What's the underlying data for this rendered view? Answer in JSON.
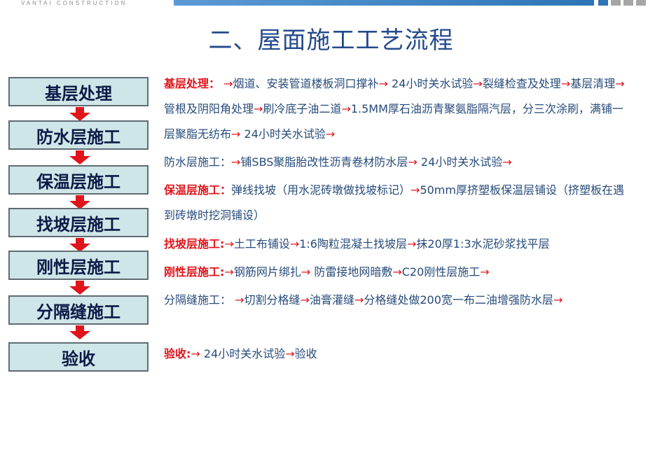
{
  "header": {
    "brand": "VANTAI CONSTRUCTION",
    "title": "二、屋面施工工艺流程"
  },
  "steps": [
    "基层处理",
    "防水层施工",
    "保温层施工",
    "找坡层施工",
    "刚性层施工",
    "分隔缝施工",
    "验收"
  ],
  "arrow_symbol": "→",
  "descriptions": {
    "jiceng": {
      "label": "基层处理：",
      "parts": [
        "烟道、安装管道楼板洞口撑补",
        " 24小时关水试验",
        "裂缝检查及处理",
        "基层清理",
        "管根及阴阳角处理",
        "刷冷底子油二道",
        "1.5MM厚石油沥青聚氨脂隔汽层，分三次涂刷，满铺一层聚脂无纺布",
        " 24小时关水试验"
      ]
    },
    "fangshui": {
      "label": "防水层施工：",
      "parts": [
        "铺SBS聚脂胎改性沥青卷材防水层",
        " 24小时关水试验"
      ]
    },
    "baowen": {
      "label": "保温层施工：",
      "parts": [
        "弹线找坡（用水泥砖墩做找坡标记）",
        "50mm厚挤塑板保温层铺设（挤塑板在遇到砖墩时挖洞铺设）"
      ]
    },
    "zhaopo": {
      "label": "找坡层施工:",
      "parts": [
        "土工布铺设",
        "1:6陶粒混凝土找坡层",
        "抹20厚1:3水泥砂浆找平层"
      ]
    },
    "gangxing": {
      "label": "刚性层施工:",
      "parts": [
        "钢筋网片绑扎",
        " 防雷接地网暗敷",
        "C20刚性层施工"
      ]
    },
    "fenge": {
      "label": "分隔缝施工：",
      "parts": [
        "切割分格缝",
        "油膏灌缝",
        "分格缝处做200宽一布二油增强防水层"
      ]
    },
    "yanshou": {
      "label": "验收:",
      "parts": [
        " 24小时关水试验",
        "验收"
      ]
    }
  }
}
